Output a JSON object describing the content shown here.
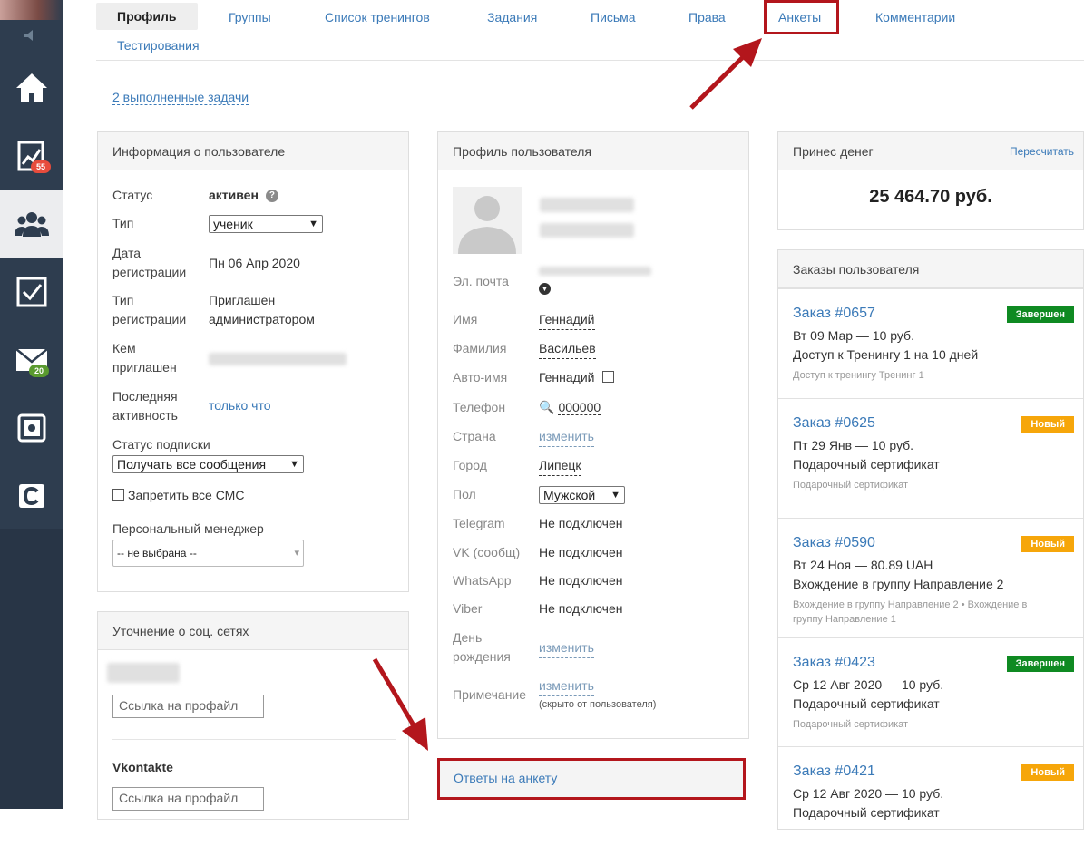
{
  "sidebar": {
    "badges": {
      "analytics": "55",
      "mail": "20"
    }
  },
  "tabs": {
    "profile": "Профиль",
    "groups": "Группы",
    "trainings": "Список тренингов",
    "tasks": "Задания",
    "letters": "Письма",
    "rights": "Права",
    "surveys": "Анкеты",
    "comments": "Комментарии",
    "testing": "Тестирования"
  },
  "done_tasks": "2 выполненные задачи",
  "user_info": {
    "title": "Информация о пользователе",
    "status_label": "Статус",
    "status_value": "активен",
    "type_label": "Тип",
    "type_value": "ученик",
    "reg_date_label_1": "Дата",
    "reg_date_label_2": "регистрации",
    "reg_date_value": "Пн 06 Апр 2020",
    "reg_type_label_1": "Тип",
    "reg_type_label_2": "регистрации",
    "reg_type_value_1": "Приглашен",
    "reg_type_value_2": "администратором",
    "invited_label_1": "Кем",
    "invited_label_2": "приглашен",
    "last_activity_label_1": "Последняя",
    "last_activity_label_2": "активность",
    "last_activity_value": "только что",
    "subscription_label": "Статус подписки",
    "subscription_value": "Получать все сообщения",
    "sms_label": "Запретить все СМС",
    "manager_label": "Персональный менеджер",
    "manager_value": "-- не выбрана --"
  },
  "social": {
    "title": "Уточнение о соц. сетях",
    "link_placeholder": "Ссылка на профайл",
    "vk_label": "Vkontakte",
    "vk_placeholder": "Ссылка на профайл"
  },
  "profile": {
    "title": "Профиль пользователя",
    "email_label": "Эл. почта",
    "name_label": "Имя",
    "name_value": "Геннадий",
    "surname_label": "Фамилия",
    "surname_value": "Васильев",
    "autoname_label": "Авто-имя",
    "autoname_value": "Геннадий",
    "phone_label": "Телефон",
    "phone_value": "000000",
    "country_label": "Страна",
    "country_value": "изменить",
    "city_label": "Город",
    "city_value": "Липецк",
    "gender_label": "Пол",
    "gender_value": "Мужской",
    "telegram_label": "Telegram",
    "telegram_value": "Не подключен",
    "vk_label": "VK (сообщ)",
    "vk_value": "Не подключен",
    "whatsapp_label": "WhatsApp",
    "whatsapp_value": "Не подключен",
    "viber_label": "Viber",
    "viber_value": "Не подключен",
    "birthday_label_1": "День",
    "birthday_label_2": "рождения",
    "birthday_value": "изменить",
    "note_label": "Примечание",
    "note_value": "изменить",
    "note_hint": "(скрыто от пользователя)",
    "answers_link": "Ответы на анкету"
  },
  "money": {
    "title": "Принес денег",
    "recalc": "Пересчитать",
    "amount": "25 464.70 руб."
  },
  "orders": {
    "title": "Заказы пользователя",
    "items": [
      {
        "title": "Заказ #0657",
        "badge": "Завершен",
        "line1": "Вт 09 Мар — 10 руб.",
        "line2": "Доступ к Тренингу 1 на 10 дней",
        "small1": "Доступ к тренингу Тренинг 1",
        "small2": "",
        "color": "#0f8a22"
      },
      {
        "title": "Заказ #0625",
        "badge": "Новый",
        "line1": "Пт 29 Янв — 10 руб.",
        "line2": "Подарочный сертификат",
        "small1": "Подарочный сертификат",
        "small2": "",
        "color": "#f6a60a"
      },
      {
        "title": "Заказ #0590",
        "badge": "Новый",
        "line1": "Вт 24 Ноя — 80.89 UAH",
        "line2": "Вхождение в группу Направление 2",
        "small1": "Вхождение в группу Направление 2 • Вхождение в",
        "small2": "группу Направление 1",
        "color": "#f6a60a"
      },
      {
        "title": "Заказ #0423",
        "badge": "Завершен",
        "line1": "Ср 12 Авг 2020 — 10 руб.",
        "line2": "Подарочный сертификат",
        "small1": "Подарочный сертификат",
        "small2": "",
        "color": "#0f8a22"
      },
      {
        "title": "Заказ #0421",
        "badge": "Новый",
        "line1": "Ср 12 Авг 2020 — 10 руб.",
        "line2": "Подарочный сертификат",
        "small1": "",
        "small2": "",
        "color": "#f6a60a"
      }
    ]
  },
  "colors": {
    "highlight": "#b3161c",
    "link": "#3b7ab8",
    "sidebar": "#2e3d4f"
  }
}
